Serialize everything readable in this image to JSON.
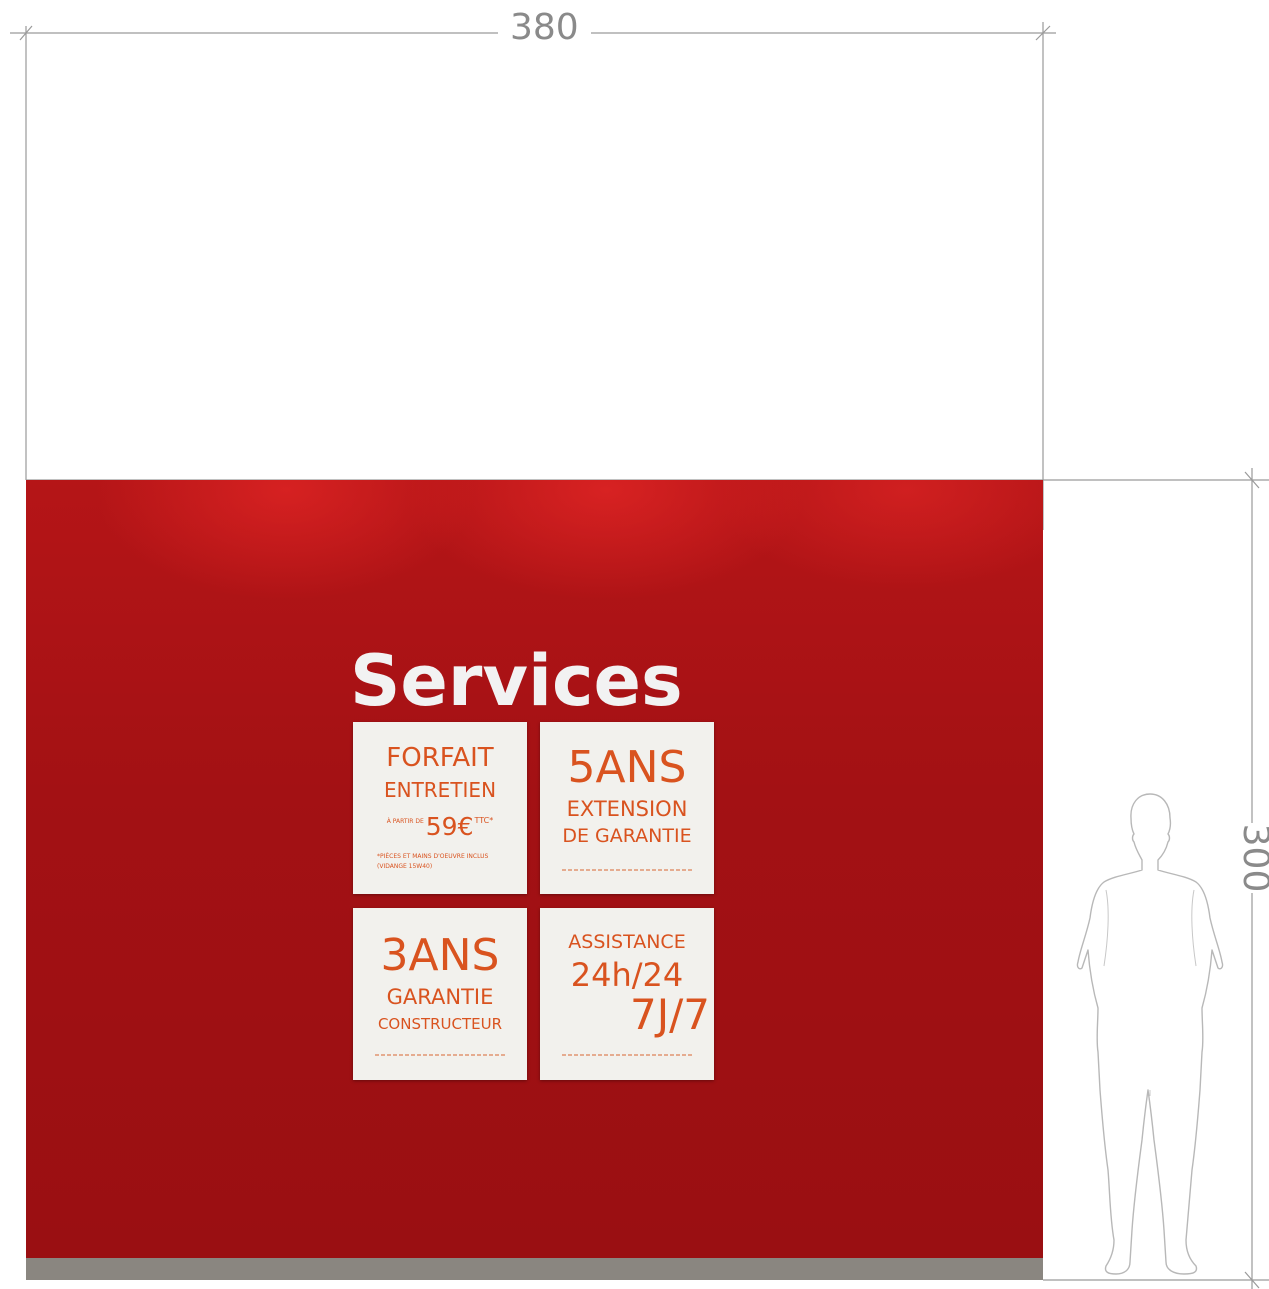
{
  "dimensions": {
    "width": "380",
    "height": "300"
  },
  "colors": {
    "wall": "#a31114",
    "panel": "#f2f1ed",
    "panel_text": "#d9531f",
    "title": "#f2f2f2",
    "dimension_lines": "#9a9a9a"
  },
  "wall": {
    "title": "Services",
    "panels": [
      {
        "line1": "FORFAIT",
        "line2": "ENTRETIEN",
        "price_prefix": "À PARTIR DE",
        "price": "59€",
        "price_suffix": "TTC*",
        "note1": "*PIÈCES ET MAINS D'OEUVRE INCLUS",
        "note2": "(VIDANGE 15W40)"
      },
      {
        "line1": "5ANS",
        "line2": "EXTENSION",
        "line3": "DE GARANTIE"
      },
      {
        "line1": "3ANS",
        "line2": "GARANTIE",
        "line3": "CONSTRUCTEUR"
      },
      {
        "line1": "ASSISTANCE",
        "line2": "24h/24",
        "line3": "7J/7"
      }
    ]
  },
  "icons": {
    "person": "person-silhouette-icon"
  }
}
